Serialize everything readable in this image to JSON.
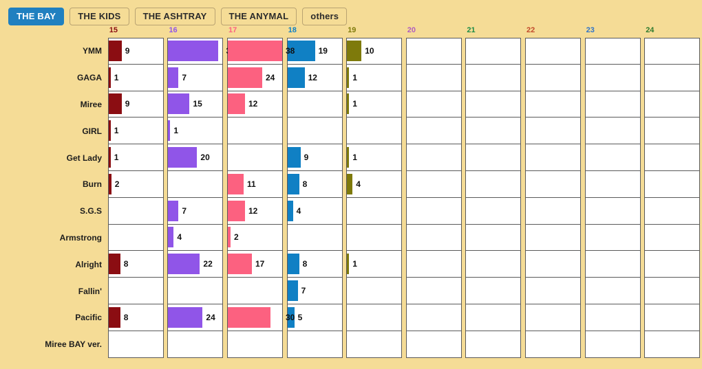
{
  "tabs": [
    {
      "label": "THE BAY",
      "active": true
    },
    {
      "label": "THE KIDS",
      "active": false
    },
    {
      "label": "THE ASHTRAY",
      "active": false
    },
    {
      "label": "THE ANYMAL",
      "active": false
    },
    {
      "label": "others",
      "active": false
    }
  ],
  "theme": {
    "background": "#F5DC96",
    "grid_line": "#595959",
    "cell_bg": "#FFFFFF",
    "active_tab_bg": "#2080C0",
    "active_tab_text": "#FFFFFF",
    "tab_text": "#2B2B2B",
    "tab_border": "#B9A372",
    "label_text": "#1D1D1D"
  },
  "chart_data": {
    "type": "bar",
    "title": "",
    "xlabel": "",
    "ylabel": "",
    "grid": true,
    "legend": "none",
    "orientation": "horizontal-grouped-by-column",
    "categories": [
      "YMM",
      "GAGA",
      "Miree",
      "GIRL",
      "Get Lady",
      "Burn",
      "S.G.S",
      "Armstrong",
      "Alright",
      "Fallin'",
      "Pacific",
      "Miree BAY ver."
    ],
    "columns": [
      {
        "label": "15",
        "color": "#8B0D12"
      },
      {
        "label": "16",
        "color": "#9055E8"
      },
      {
        "label": "17",
        "color": "#FC6180"
      },
      {
        "label": "18",
        "color": "#1080C4"
      },
      {
        "label": "19",
        "color": "#7E7A0B"
      },
      {
        "label": "20",
        "color": "#B05DBF"
      },
      {
        "label": "21",
        "color": "#1C8B46"
      },
      {
        "label": "22",
        "color": "#C24A2B"
      },
      {
        "label": "23",
        "color": "#2F74C8"
      },
      {
        "label": "24",
        "color": "#2E7A2E"
      }
    ],
    "max_value": 38,
    "series": [
      {
        "name": "15",
        "values": [
          9,
          1,
          9,
          1,
          1,
          2,
          null,
          null,
          8,
          null,
          8,
          null
        ]
      },
      {
        "name": "16",
        "values": [
          35,
          7,
          15,
          1,
          20,
          null,
          7,
          4,
          22,
          null,
          24,
          null
        ]
      },
      {
        "name": "17",
        "values": [
          38,
          24,
          12,
          null,
          null,
          11,
          12,
          2,
          17,
          null,
          30,
          null
        ]
      },
      {
        "name": "18",
        "values": [
          19,
          12,
          null,
          null,
          9,
          8,
          4,
          null,
          8,
          7,
          5,
          null
        ]
      },
      {
        "name": "19",
        "values": [
          10,
          1,
          1,
          null,
          1,
          4,
          null,
          null,
          1,
          null,
          null,
          null
        ]
      },
      {
        "name": "20",
        "values": [
          null,
          null,
          null,
          null,
          null,
          null,
          null,
          null,
          null,
          null,
          null,
          null
        ]
      },
      {
        "name": "21",
        "values": [
          null,
          null,
          null,
          null,
          null,
          null,
          null,
          null,
          null,
          null,
          null,
          null
        ]
      },
      {
        "name": "22",
        "values": [
          null,
          null,
          null,
          null,
          null,
          null,
          null,
          null,
          null,
          null,
          null,
          null
        ]
      },
      {
        "name": "23",
        "values": [
          null,
          null,
          null,
          null,
          null,
          null,
          null,
          null,
          null,
          null,
          null,
          null
        ]
      },
      {
        "name": "24",
        "values": [
          null,
          null,
          null,
          null,
          null,
          null,
          null,
          null,
          null,
          null,
          null,
          null
        ]
      }
    ]
  }
}
